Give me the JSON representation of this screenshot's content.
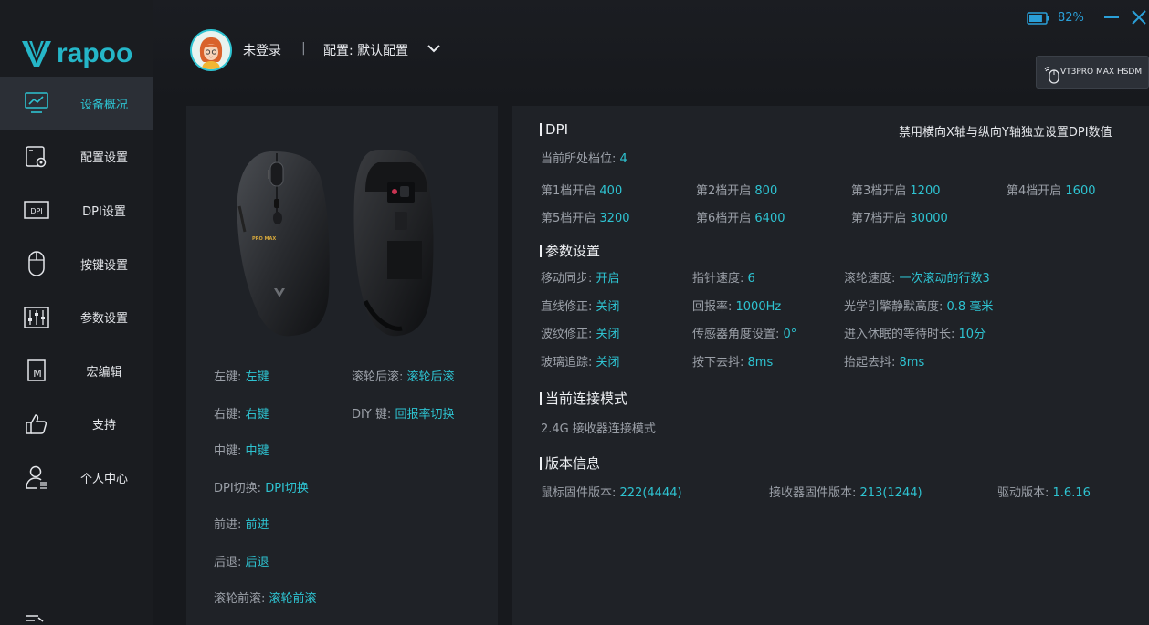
{
  "brand": {
    "logo_text": "rapoo",
    "accent": "#2ec3d1"
  },
  "header": {
    "user": "未登录",
    "separator": "|",
    "profile_label": "配置: 默认配置",
    "battery_pct": "82%",
    "battery_level": 0.82,
    "device_name": "VT3PRO MAX HSDM"
  },
  "sidebar": {
    "items": [
      {
        "label": "设备概况",
        "icon": "monitor-chart-icon",
        "active": true
      },
      {
        "label": "配置设置",
        "icon": "config-gear-icon"
      },
      {
        "label": "DPI设置",
        "icon": "dpi-icon"
      },
      {
        "label": "按键设置",
        "icon": "mouse-icon"
      },
      {
        "label": "参数设置",
        "icon": "sliders-icon"
      },
      {
        "label": "宏编辑",
        "icon": "macro-icon"
      },
      {
        "label": "支持",
        "icon": "thumbs-up-icon"
      },
      {
        "label": "个人中心",
        "icon": "user-icon"
      }
    ]
  },
  "buttons": {
    "left": {
      "k": "左键: ",
      "v": "左键"
    },
    "right": {
      "k": "右键: ",
      "v": "右键"
    },
    "middle": {
      "k": "中键: ",
      "v": "中键"
    },
    "dpi": {
      "k": "DPI切换: ",
      "v": "DPI切换"
    },
    "forward": {
      "k": "前进: ",
      "v": "前进"
    },
    "back": {
      "k": "后退: ",
      "v": "后退"
    },
    "wheel_fwd": {
      "k": "滚轮前滚: ",
      "v": "滚轮前滚"
    },
    "wheel_back": {
      "k": "滚轮后滚: ",
      "v": "滚轮后滚"
    },
    "diy": {
      "k": "DIY 键: ",
      "v": "回报率切换"
    }
  },
  "dpi": {
    "title": "DPI",
    "note": "禁用横向X轴与纵向Y轴独立设置DPI数值",
    "current_label": "当前所处档位: ",
    "current_value": "4",
    "levels": [
      {
        "k": "第1档开启 ",
        "v": "400"
      },
      {
        "k": "第2档开启 ",
        "v": "800"
      },
      {
        "k": "第3档开启 ",
        "v": "1200"
      },
      {
        "k": "第4档开启 ",
        "v": "1600"
      },
      {
        "k": "第5档开启 ",
        "v": "3200"
      },
      {
        "k": "第6档开启 ",
        "v": "6400"
      },
      {
        "k": "第7档开启 ",
        "v": "30000"
      }
    ]
  },
  "params": {
    "title": "参数设置",
    "rows": [
      {
        "k": "移动同步: ",
        "v": "开启"
      },
      {
        "k": "指针速度: ",
        "v": "6"
      },
      {
        "k": "滚轮速度: ",
        "v": "一次滚动的行数3"
      },
      {
        "k": "直线修正: ",
        "v": "关闭"
      },
      {
        "k": "回报率: ",
        "v": "1000Hz"
      },
      {
        "k": "光学引擎静默高度: ",
        "v": "0.8 毫米"
      },
      {
        "k": "波纹修正: ",
        "v": "关闭"
      },
      {
        "k": "传感器角度设置: ",
        "v": "0°"
      },
      {
        "k": "进入休眠的等待时长: ",
        "v": "10分"
      },
      {
        "k": "玻璃追踪: ",
        "v": "关闭"
      },
      {
        "k": "按下去抖: ",
        "v": "8ms"
      },
      {
        "k": "抬起去抖: ",
        "v": "8ms"
      }
    ]
  },
  "connection": {
    "title": "当前连接模式",
    "mode": "2.4G 接收器连接模式"
  },
  "version": {
    "title": "版本信息",
    "mouse_fw": {
      "k": "鼠标固件版本:  ",
      "v": "222(4444)"
    },
    "receiver_fw": {
      "k": "接收器固件版本:  ",
      "v": "213(1244)"
    },
    "driver": {
      "k": "驱动版本: ",
      "v": "1.6.16"
    }
  },
  "mouse_image": {
    "print_text": "PRO MAX"
  }
}
